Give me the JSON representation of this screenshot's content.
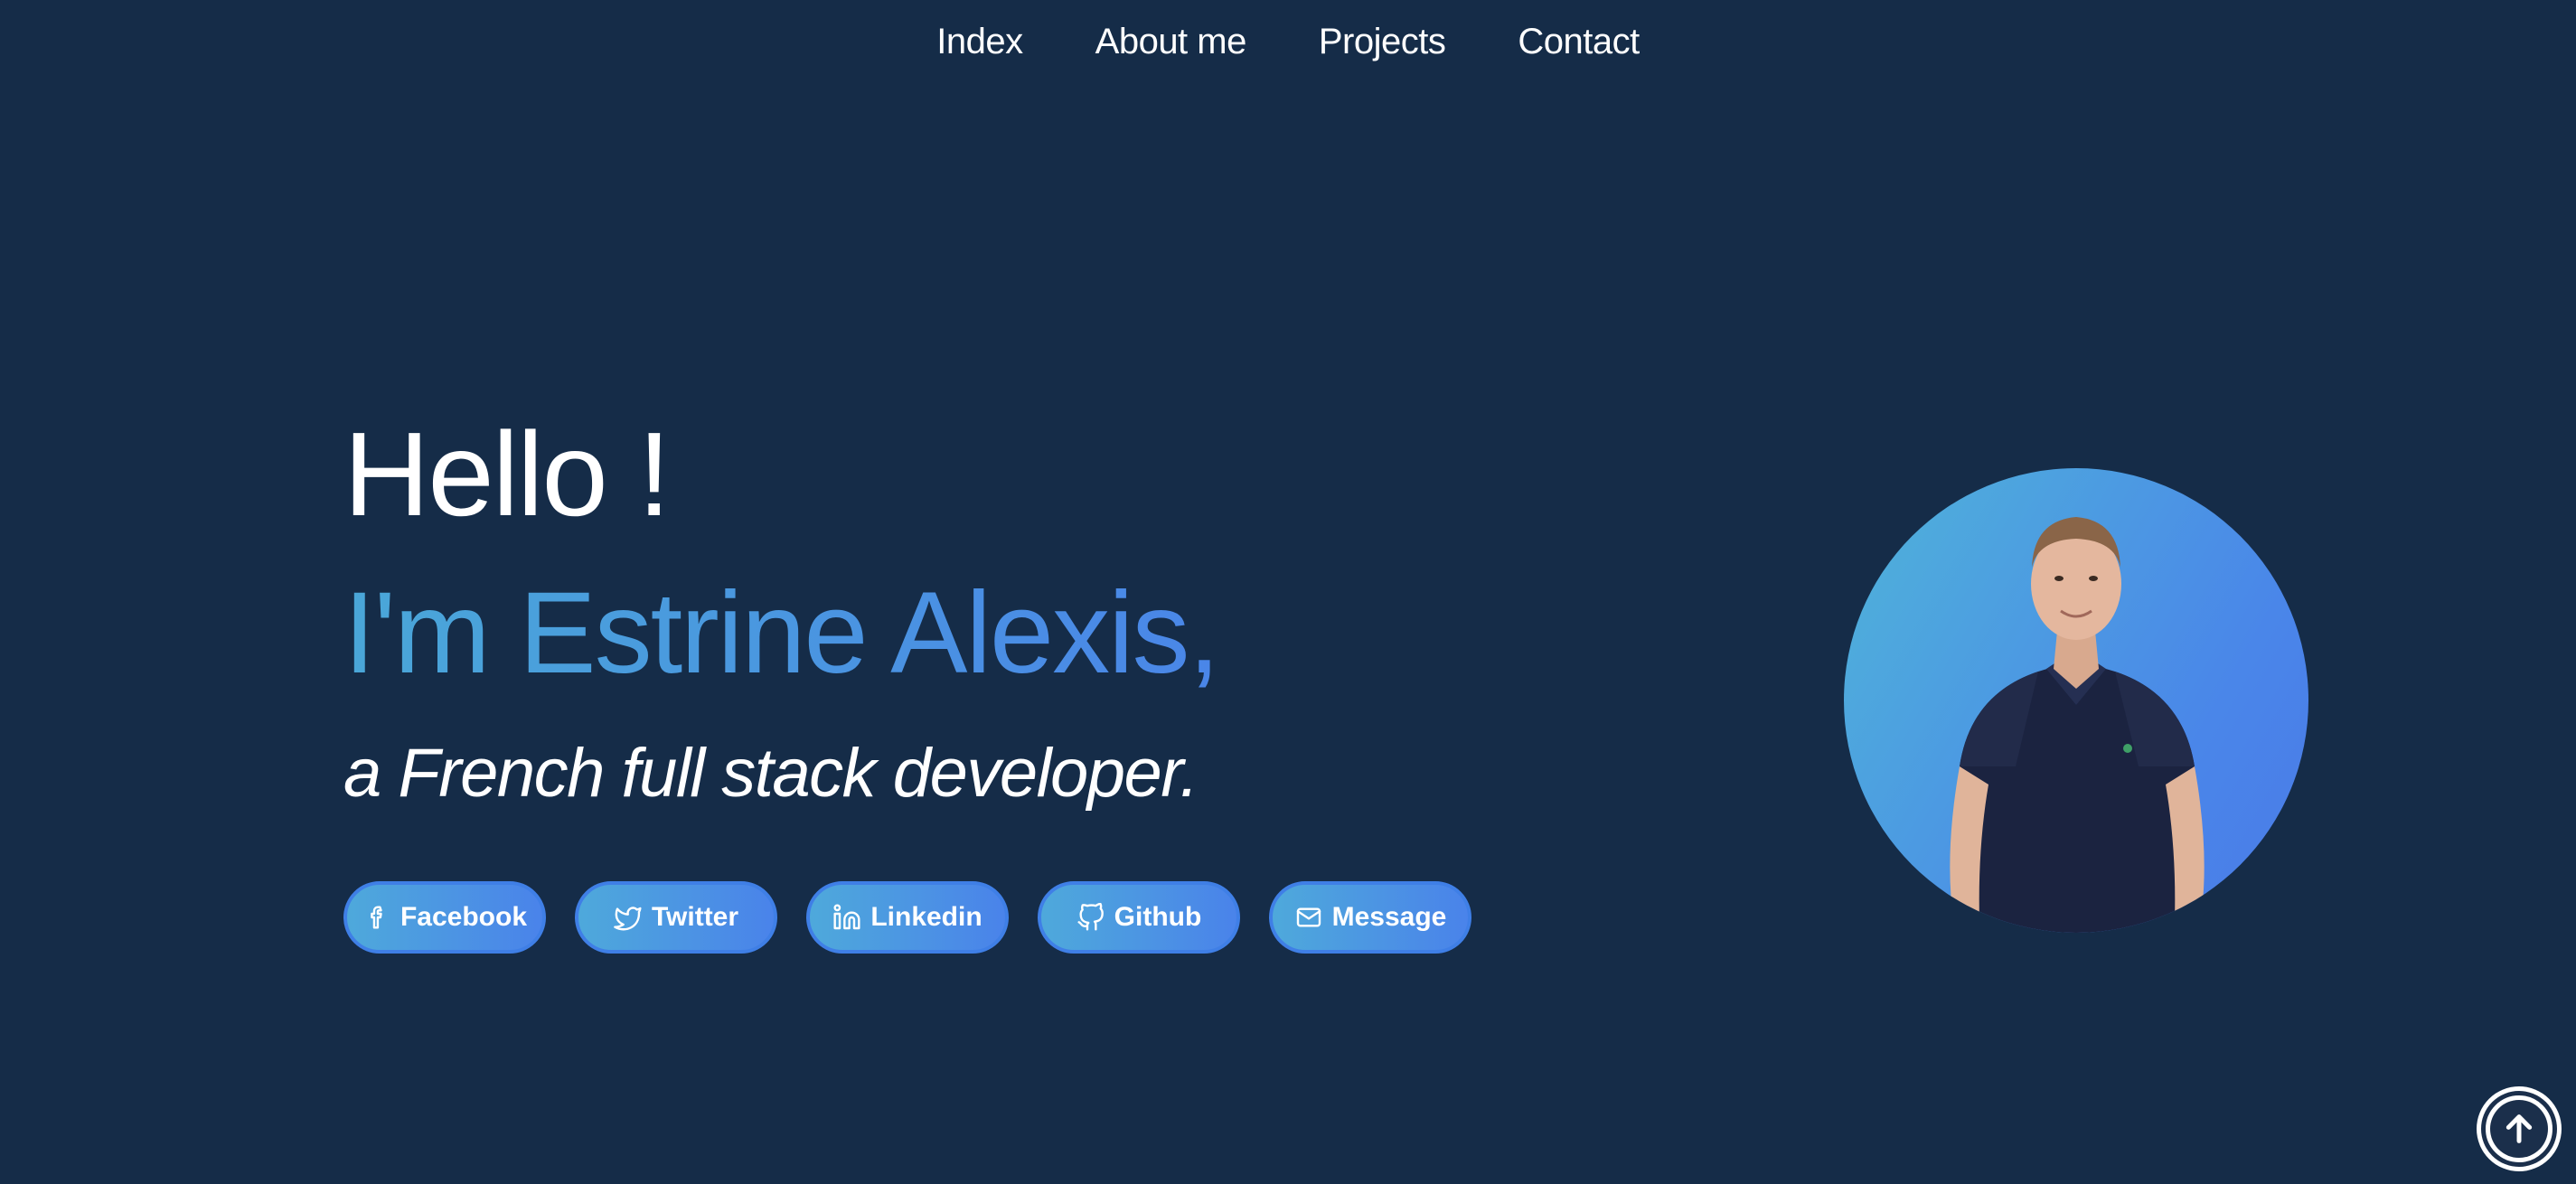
{
  "nav": {
    "items": [
      {
        "label": "Index"
      },
      {
        "label": "About me"
      },
      {
        "label": "Projects"
      },
      {
        "label": "Contact"
      }
    ]
  },
  "hero": {
    "greeting": "Hello !",
    "name_line": "I'm Estrine Alexis,",
    "tagline": "a French full stack developer."
  },
  "socials": [
    {
      "label": "Facebook",
      "icon": "facebook-icon"
    },
    {
      "label": "Twitter",
      "icon": "twitter-icon"
    },
    {
      "label": "Linkedin",
      "icon": "linkedin-icon"
    },
    {
      "label": "Github",
      "icon": "github-icon"
    },
    {
      "label": "Message",
      "icon": "mail-icon"
    }
  ],
  "avatar": {
    "icon": "profile-photo"
  },
  "back_to_top": {
    "icon": "arrow-up-icon"
  },
  "colors": {
    "background": "#152c48",
    "accent_start": "#4aa7d8",
    "accent_end": "#4a86e8",
    "text": "#ffffff"
  }
}
